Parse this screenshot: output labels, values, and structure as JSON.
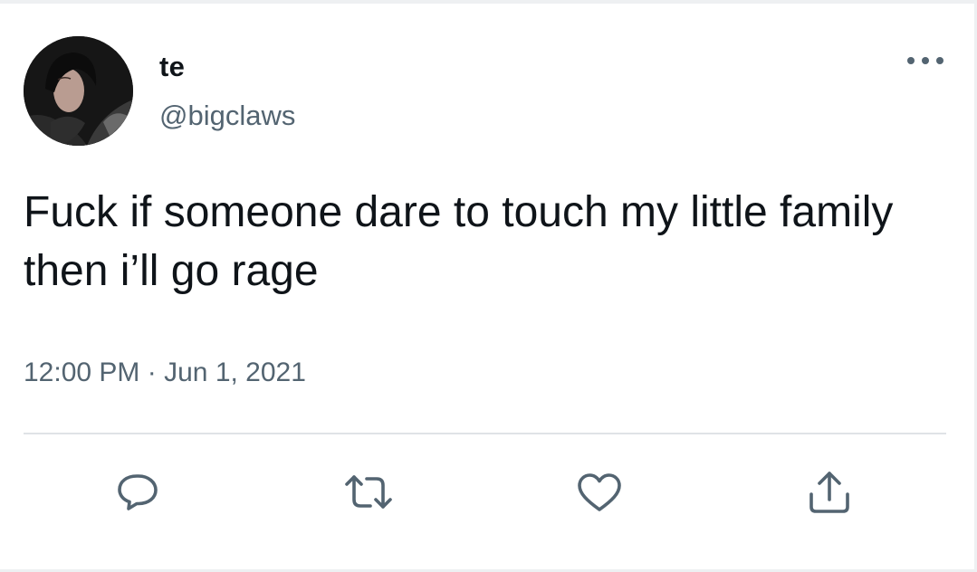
{
  "tweet": {
    "author": {
      "display_name": "te",
      "handle": "@bigclaws"
    },
    "text": "Fuck if someone dare to touch my little family then i’ll go rage",
    "time": "12:00 PM",
    "separator": "·",
    "date": "Jun 1, 2021"
  },
  "icons": {
    "more": "more-horizontal-icon",
    "reply": "reply-icon",
    "retweet": "retweet-icon",
    "like": "heart-icon",
    "share": "share-icon"
  },
  "colors": {
    "text_primary": "#0f1419",
    "text_secondary": "#536471",
    "divider": "#dfe3e6"
  }
}
